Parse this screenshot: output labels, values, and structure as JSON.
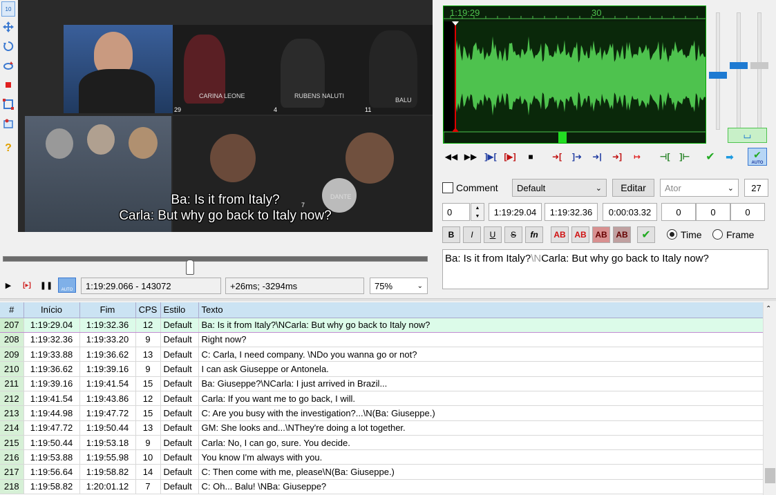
{
  "left_toolbar": {
    "icons": [
      "subtitle-position-icon",
      "move-icon",
      "rotate-z-icon",
      "rotate-xy-icon",
      "clip-icon",
      "scale-icon",
      "drawing-icon",
      "help-icon"
    ],
    "top_label": "10"
  },
  "video": {
    "line1": "Ba: Is it from Italy?",
    "line2": "Carla: But why go back to Italy now?",
    "overlays": [
      "CARINA LEONE",
      "RUBENS NALUTI",
      "BALU",
      "DANTE",
      "29",
      "4",
      "11",
      "7"
    ]
  },
  "video_controls": {
    "time_display": "1:19:29.066 - 143072",
    "offset_display": "+26ms; -3294ms",
    "zoom": "75%",
    "auto_label": "AUTO"
  },
  "audio": {
    "time_label": "1:19:29",
    "marker_label": "30",
    "auto_label": "AUTO"
  },
  "edit": {
    "comment_label": "Comment",
    "style": "Default",
    "edit_button": "Editar",
    "actor_placeholder": "Ator",
    "effect_value": "27",
    "layer": "0",
    "start": "1:19:29.04",
    "end": "1:19:32.36",
    "duration": "0:00:03.32",
    "margin_l": "0",
    "margin_r": "0",
    "margin_v": "0",
    "fmt_buttons": [
      "B",
      "I",
      "U",
      "S",
      "fn",
      "AB",
      "AB",
      "AB",
      "AB"
    ],
    "time_label": "Time",
    "frame_label": "Frame",
    "text_plain1": "Ba: Is it from Italy?",
    "text_tag": "\\N",
    "text_plain2": "Carla: But why go back to Italy now?"
  },
  "grid": {
    "headers": [
      "#",
      "Início",
      "Fim",
      "CPS",
      "Estilo",
      "Texto"
    ],
    "rows": [
      [
        "207",
        "1:19:29.04",
        "1:19:32.36",
        "12",
        "Default",
        "Ba: Is it from Italy?\\NCarla: But why go back to Italy now?"
      ],
      [
        "208",
        "1:19:32.36",
        "1:19:33.20",
        "9",
        "Default",
        "Right now?"
      ],
      [
        "209",
        "1:19:33.88",
        "1:19:36.62",
        "13",
        "Default",
        "C: Carla, I need company. \\NDo you wanna go or not?"
      ],
      [
        "210",
        "1:19:36.62",
        "1:19:39.16",
        "9",
        "Default",
        "I can ask Giuseppe or Antonela."
      ],
      [
        "211",
        "1:19:39.16",
        "1:19:41.54",
        "15",
        "Default",
        "Ba: Giuseppe?\\NCarla: I just arrived in Brazil..."
      ],
      [
        "212",
        "1:19:41.54",
        "1:19:43.86",
        "12",
        "Default",
        "Carla: If you want me to go back, I will."
      ],
      [
        "213",
        "1:19:44.98",
        "1:19:47.72",
        "15",
        "Default",
        "C: Are you busy with the investigation?...\\N(Ba: Giuseppe.)"
      ],
      [
        "214",
        "1:19:47.72",
        "1:19:50.44",
        "13",
        "Default",
        "GM: She looks and...\\NThey're doing a lot together."
      ],
      [
        "215",
        "1:19:50.44",
        "1:19:53.18",
        "9",
        "Default",
        "Carla: No, I can go, sure. You decide."
      ],
      [
        "216",
        "1:19:53.88",
        "1:19:55.98",
        "10",
        "Default",
        "You know I'm always with you."
      ],
      [
        "217",
        "1:19:56.64",
        "1:19:58.82",
        "14",
        "Default",
        "C: Then come with me, please\\N(Ba: Giuseppe.)"
      ],
      [
        "218",
        "1:19:58.82",
        "1:20:01.12",
        "7",
        "Default",
        "C: Oh... Balu! \\NBa: Giuseppe?"
      ]
    ]
  },
  "colors": {
    "wave_bg": "#0a280a",
    "wave_fg": "#4ec24e",
    "playhead": "#e00000",
    "grid_header": "#cbe3f3",
    "selected_row": "#dcfbe9"
  }
}
